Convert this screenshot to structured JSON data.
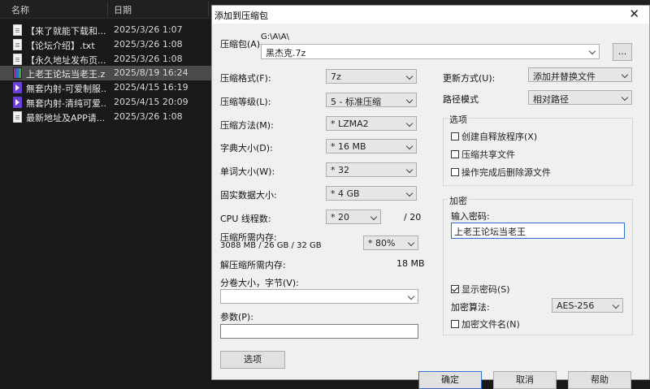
{
  "explorer": {
    "columns": {
      "name": "名称",
      "date": "日期"
    },
    "files": [
      {
        "name": "【来了就能下载和...",
        "date": "2025/3/26 1:07",
        "icon": "document-icon"
      },
      {
        "name": "【论坛介绍】.txt",
        "date": "2025/3/26 1:08",
        "icon": "document-icon"
      },
      {
        "name": "【永久地址发布页...",
        "date": "2025/3/26 1:08",
        "icon": "document-icon"
      },
      {
        "name": "上老王论坛当老王.z...",
        "date": "2025/8/19 16:24",
        "icon": "archive-icon",
        "selected": true
      },
      {
        "name": "無套内射-可爱制服...",
        "date": "2025/4/15 16:19",
        "icon": "video-icon"
      },
      {
        "name": "無套内射-清纯可爱...",
        "date": "2025/4/15 20:09",
        "icon": "video-icon"
      },
      {
        "name": "最新地址及APP请...",
        "date": "2025/3/26 1:08",
        "icon": "document-icon"
      }
    ]
  },
  "dialog": {
    "title": "添加到压缩包",
    "archive_label": "压缩包(A)",
    "archive_path": "G:\\A\\A\\",
    "archive_name": "黑杰克.7z",
    "browse_label": "...",
    "format_label": "压缩格式(F):",
    "format_value": "7z",
    "level_label": "压缩等级(L):",
    "level_value": "5 - 标准压缩",
    "method_label": "压缩方法(M):",
    "method_value": "* LZMA2",
    "dict_label": "字典大小(D):",
    "dict_value": "* 16 MB",
    "word_label": "单词大小(W):",
    "word_value": "* 32",
    "solid_label": "固实数据大小:",
    "solid_value": "* 4 GB",
    "cpu_label": "CPU 线程数:",
    "cpu_value": "* 20",
    "cpu_total": "/ 20",
    "mem_label": "压缩所需内存:",
    "mem_value": "3088 MB / 26 GB / 32 GB",
    "mem_percent": "* 80%",
    "decomp_label": "解压缩所需内存:",
    "decomp_value": "18 MB",
    "volume_label": "分卷大小，字节(V):",
    "volume_value": "",
    "params_label": "参数(P):",
    "params_value": "",
    "options_button": "选项",
    "update_label": "更新方式(U):",
    "update_value": "添加并替换文件",
    "path_label": "路径模式",
    "path_value": "相对路径",
    "options_group": "选项",
    "opt_sfx": "创建自释放程序(X)",
    "opt_shared": "压缩共享文件",
    "opt_delete": "操作完成后删除源文件",
    "encrypt_group": "加密",
    "password_label": "输入密码:",
    "password_value": "上老王论坛当老王",
    "show_password": "显示密码(S)",
    "show_password_checked": true,
    "enc_method_label": "加密算法:",
    "enc_method_value": "AES-256",
    "encrypt_names": "加密文件名(N)",
    "ok_button": "确定",
    "cancel_button": "取消",
    "help_button": "帮助"
  }
}
